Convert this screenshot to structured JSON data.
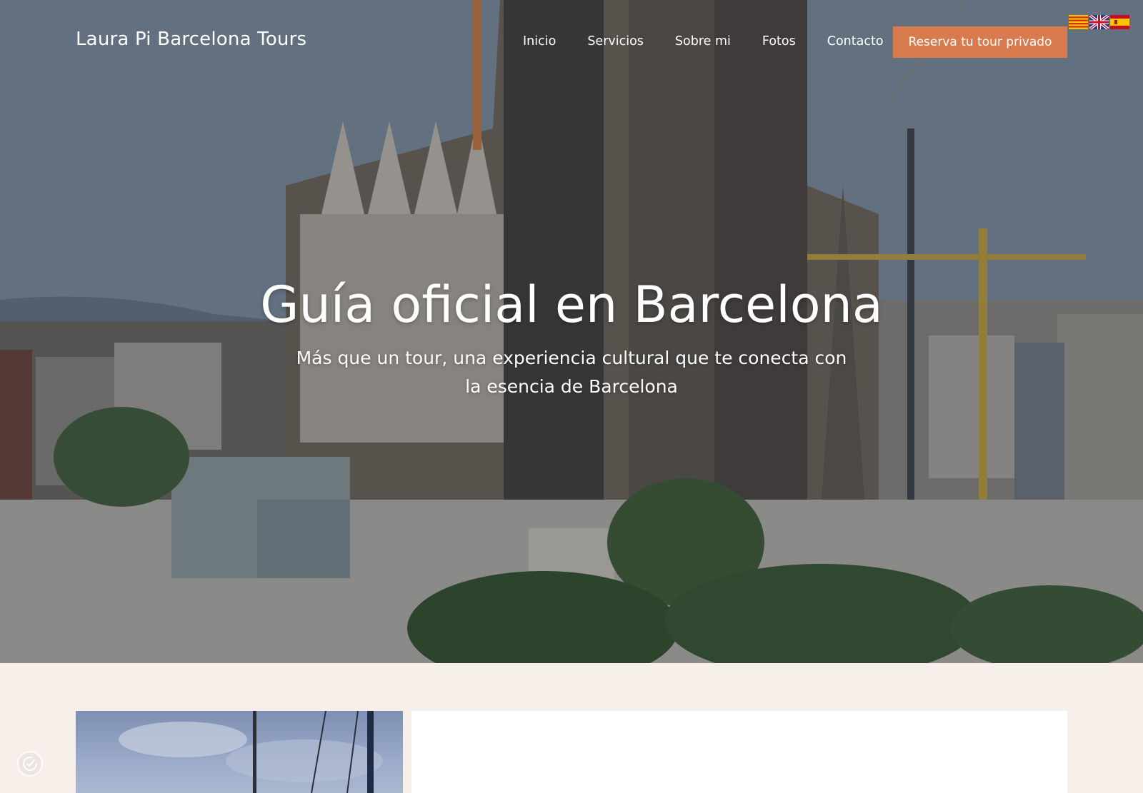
{
  "brand": {
    "name": "Laura Pi Barcelona Tours"
  },
  "nav": {
    "items": [
      {
        "label": "Inicio"
      },
      {
        "label": "Servicios"
      },
      {
        "label": "Sobre mi"
      },
      {
        "label": "Fotos"
      },
      {
        "label": "Contacto"
      }
    ],
    "cta_label": "Reserva tu tour privado"
  },
  "languages": [
    {
      "icon": "catalan-flag-icon"
    },
    {
      "icon": "uk-flag-icon"
    },
    {
      "icon": "spain-flag-icon"
    }
  ],
  "hero": {
    "title": "Guía oficial en Barcelona",
    "subtitle": "Más que un tour, una experiencia cultural que te conecta con la esencia de Barcelona",
    "background": "sagrada-familia-aerial-photo"
  },
  "colors": {
    "accent": "#d77b4e",
    "page_background": "#f7f0ea",
    "text_on_hero": "#ffffff"
  },
  "widgets": {
    "cookie_icon": "cookie-consent-icon"
  }
}
